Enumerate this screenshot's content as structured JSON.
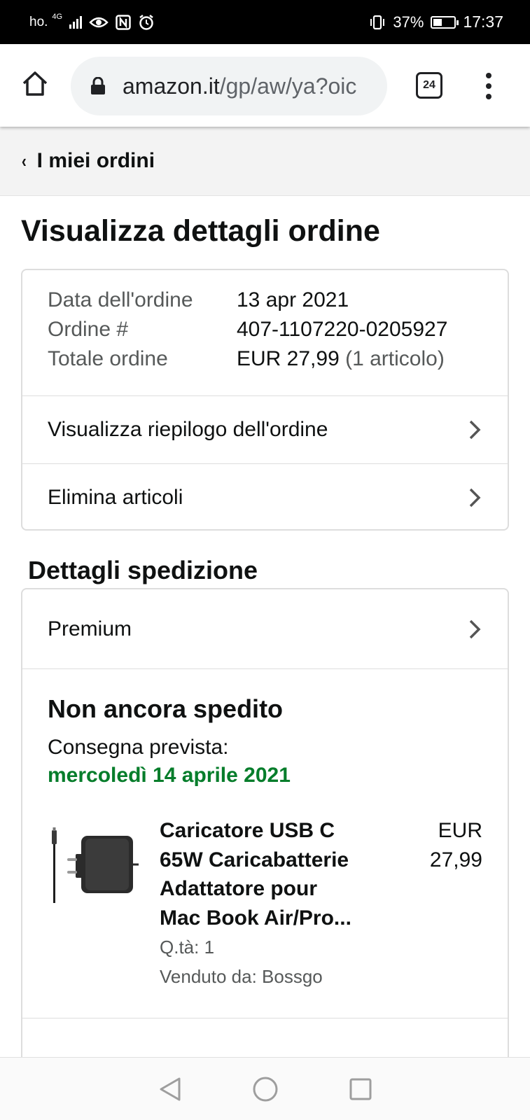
{
  "status_bar": {
    "carrier": "ho.",
    "network": "4G",
    "battery_pct": "37%",
    "time": "17:37"
  },
  "browser": {
    "url_host": "amazon.it",
    "url_path": "/gp/aw/ya?oic",
    "tab_count": "24"
  },
  "back_nav": {
    "label": "I miei ordini"
  },
  "page_title": "Visualizza dettagli ordine",
  "order": {
    "date_label": "Data dell'ordine",
    "date_value": "13 apr 2021",
    "number_label": "Ordine #",
    "number_value": "407-1107220-0205927",
    "total_label": "Totale ordine",
    "total_value": "EUR 27,99",
    "total_items": "(1 articolo)",
    "links": [
      {
        "label": "Visualizza riepilogo dell'ordine"
      },
      {
        "label": "Elimina articoli"
      }
    ]
  },
  "shipping": {
    "section_title": "Dettagli spedizione",
    "method": "Premium",
    "status": "Non ancora spedito",
    "delivery_label": "Consegna prevista:",
    "delivery_date": "mercoledì 14 aprile 2021",
    "delivery_color": "#067d2b",
    "product": {
      "name_lines": [
        "Caricatore USB C",
        "65W Caricabatterie",
        "Adattatore pour",
        "Mac Book Air/Pro..."
      ],
      "quantity": "Q.tà: 1",
      "seller": "Venduto da: Bossgo",
      "price_currency": "EUR",
      "price_value": "27,99",
      "image_icon": "usb-c-charger-image"
    }
  },
  "nav_bar": {
    "icons": [
      "back-triangle-icon",
      "home-circle-icon",
      "recents-square-icon"
    ]
  }
}
